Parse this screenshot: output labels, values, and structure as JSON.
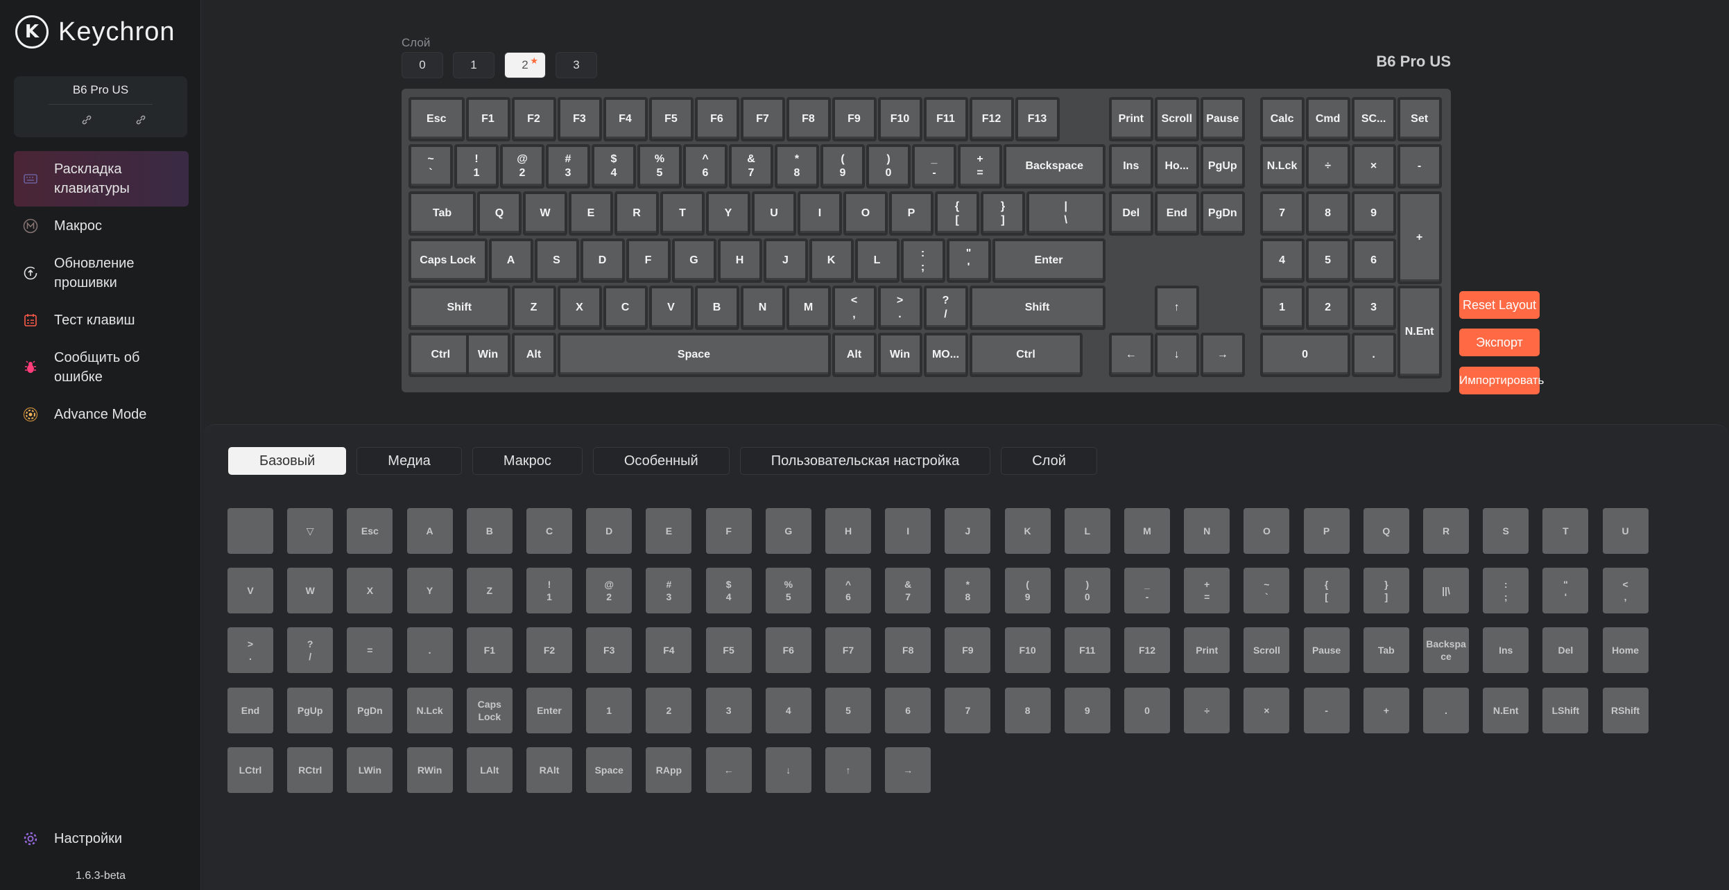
{
  "app": {
    "logo_text": "Keychron",
    "logo_mark": "K"
  },
  "device": {
    "name": "B6 Pro US",
    "link1": "🔗",
    "link2": "🔗"
  },
  "nav": [
    {
      "label": "Раскладка клавиатуры",
      "icon": "keyboard-icon",
      "active": true
    },
    {
      "label": "Макрос",
      "icon": "macro-icon",
      "active": false
    },
    {
      "label": "Обновление прошивки",
      "icon": "firmware-update-icon",
      "active": false
    },
    {
      "label": "Тест клавиш",
      "icon": "key-test-icon",
      "active": false
    },
    {
      "label": "Сообщить об ошибке",
      "icon": "bug-icon",
      "active": false
    },
    {
      "label": "Advance Mode",
      "icon": "advance-mode-icon",
      "active": false
    }
  ],
  "settings": {
    "label": "Настройки",
    "icon": "gear-icon"
  },
  "version": "1.6.3-beta",
  "layers": {
    "label": "Слой",
    "tabs": [
      "0",
      "1",
      "2",
      "3"
    ],
    "active": 2
  },
  "model_title": "B6 Pro US",
  "actions": {
    "reset": "Reset Layout",
    "export": "Экспорт",
    "import": "Импортировать"
  },
  "keyboard": {
    "row1": [
      "Esc",
      "F1",
      "F2",
      "F3",
      "F4",
      "F5",
      "F6",
      "F7",
      "F8",
      "F9",
      "F10",
      "F11",
      "F12",
      "F13"
    ],
    "row2": [
      [
        "~",
        "`"
      ],
      [
        "!",
        "1"
      ],
      [
        "@",
        "2"
      ],
      [
        "#",
        "3"
      ],
      [
        "$",
        "4"
      ],
      [
        "%",
        "5"
      ],
      [
        "^",
        "6"
      ],
      [
        "&",
        "7"
      ],
      [
        "*",
        "8"
      ],
      [
        "(",
        "9"
      ],
      [
        ")",
        "0"
      ],
      [
        "_",
        "-"
      ],
      [
        "+",
        "="
      ],
      [
        "Backspace"
      ]
    ],
    "row3": [
      "Tab",
      "Q",
      "W",
      "E",
      "R",
      "T",
      "Y",
      "U",
      "I",
      "O",
      "P",
      [
        "{",
        "["
      ],
      [
        "}",
        "]"
      ],
      [
        "|",
        "\\"
      ]
    ],
    "row4": [
      "Caps Lock",
      "A",
      "S",
      "D",
      "F",
      "G",
      "H",
      "J",
      "K",
      "L",
      [
        ":",
        ";"
      ],
      [
        "\"",
        "'"
      ],
      "Enter"
    ],
    "row5": [
      "Shift",
      "Z",
      "X",
      "C",
      "V",
      "B",
      "N",
      "M",
      [
        "<",
        ","
      ],
      [
        ">",
        "."
      ],
      [
        "?",
        "/"
      ],
      "Shift"
    ],
    "row6": [
      "Ctrl",
      "Win",
      "Alt",
      "Space",
      "Alt",
      "Win",
      "MO...",
      "Ctrl"
    ],
    "nav1": [
      "Print",
      "Scroll",
      "Pause"
    ],
    "nav2": [
      "Ins",
      "Ho...",
      "PgUp"
    ],
    "nav3": [
      "Del",
      "End",
      "PgDn"
    ],
    "arrows": [
      "↑",
      "←",
      "↓",
      "→"
    ],
    "numpad1": [
      "Calc",
      "Cmd",
      "SC...",
      "Set"
    ],
    "numpad2": [
      "N.Lck",
      "÷",
      "×",
      "-"
    ],
    "numpad3": [
      "7",
      "8",
      "9",
      "+"
    ],
    "numpad4": [
      "4",
      "5",
      "6"
    ],
    "numpad5": [
      "1",
      "2",
      "3",
      "N.Ent"
    ],
    "numpad6": [
      "0",
      "."
    ]
  },
  "categories": {
    "tabs": [
      "Базовый",
      "Медиа",
      "Макрос",
      "Особенный",
      "Пользовательская настройка",
      "Слой"
    ],
    "active": 0
  },
  "palette": [
    [
      "",
      "▽",
      "Esc",
      "A",
      "B",
      "C",
      "D",
      "E",
      "F",
      "G",
      "H",
      "I",
      "J",
      "K",
      "L",
      "M",
      "N",
      "O",
      "P",
      "Q",
      "R",
      "S",
      "T",
      "U"
    ],
    [
      "V",
      "W",
      "X",
      "Y",
      "Z",
      "!|1",
      "@|2",
      "#|3",
      "$|4",
      "%|5",
      "^|6",
      "&|7",
      "*|8",
      "(|9",
      ")|0",
      "_|-",
      "+|=",
      "~|`",
      "{|[",
      "}|]",
      "||\\",
      ":|;",
      "\"|'",
      "<|,"
    ],
    [
      ">|.",
      "?|/",
      "=",
      ".",
      "F1",
      "F2",
      "F3",
      "F4",
      "F5",
      "F6",
      "F7",
      "F8",
      "F9",
      "F10",
      "F11",
      "F12",
      "Print",
      "Scroll",
      "Pause",
      "Tab",
      "Backspa|ce",
      "Ins",
      "Del",
      "Home"
    ],
    [
      "End",
      "PgUp",
      "PgDn",
      "N.Lck",
      "Caps|Lock",
      "Enter",
      "1",
      "2",
      "3",
      "4",
      "5",
      "6",
      "7",
      "8",
      "9",
      "0",
      "÷",
      "×",
      "-",
      "+",
      ".",
      "N.Ent",
      "LShift",
      "RShift"
    ],
    [
      "LCtrl",
      "RCtrl",
      "LWin",
      "RWin",
      "LAlt",
      "RAlt",
      "Space",
      "RApp",
      "←",
      "↓",
      "↑",
      "→"
    ]
  ],
  "colors": {
    "accent": "#ff6a45",
    "key": "#5b5c5e",
    "frame": "#474849"
  }
}
